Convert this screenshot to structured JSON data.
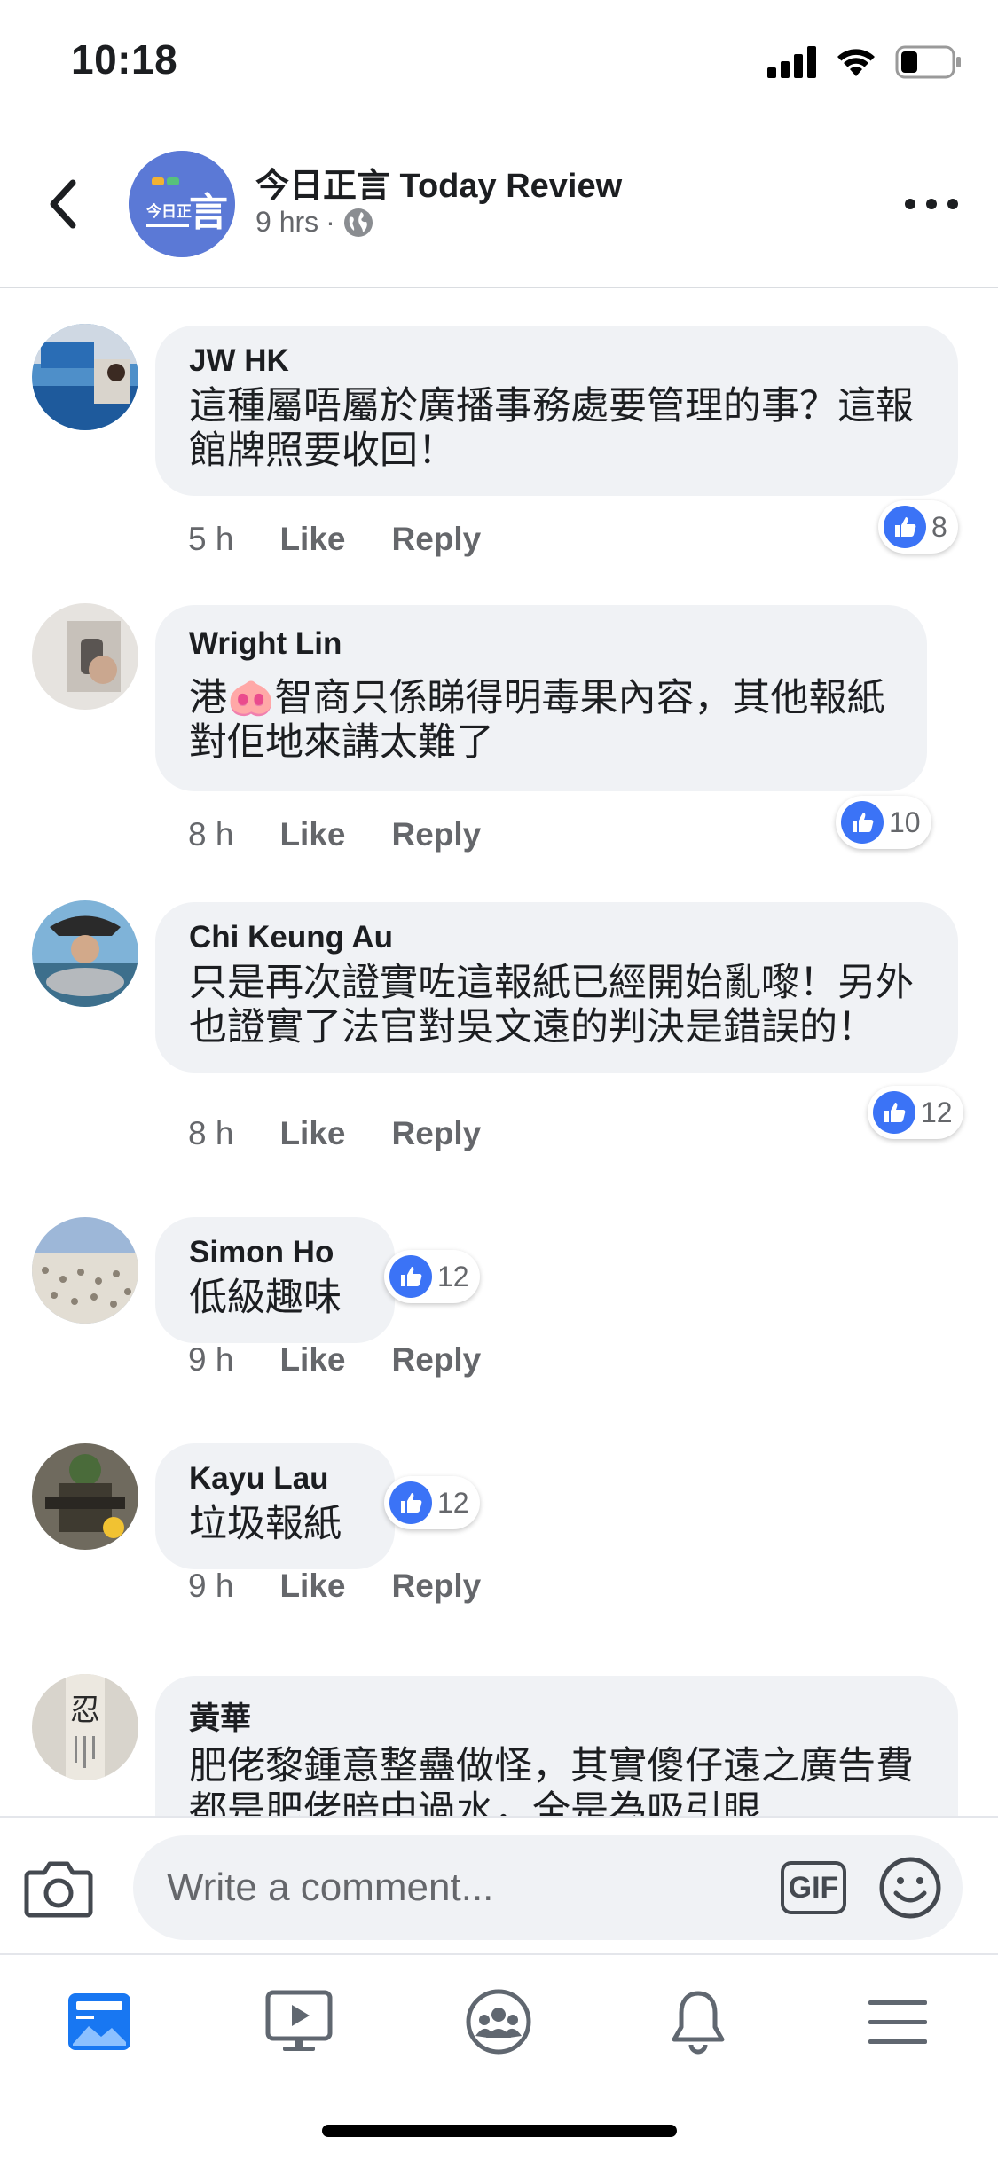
{
  "status_bar": {
    "time": "10:18"
  },
  "header": {
    "page_name": "今日正言 Today Review",
    "time_ago": "9 hrs",
    "separator": "·",
    "avatar_logo_text_top": "今日正",
    "avatar_logo_text_big": "言"
  },
  "comments": [
    {
      "author": "JW HK",
      "text": "這種屬唔屬於廣播事務處要管理的事？這報館牌照要收回！",
      "time": "5 h",
      "like_label": "Like",
      "reply_label": "Reply",
      "reaction_count": "8"
    },
    {
      "author": "Wright Lin",
      "text_before_emoji": "港",
      "emoji": "🐽",
      "text_after_emoji": "智商只係睇得明毒果內容，其他報紙對佢地來講太難了",
      "time": "8 h",
      "like_label": "Like",
      "reply_label": "Reply",
      "reaction_count": "10"
    },
    {
      "author": "Chi Keung Au",
      "text": "只是再次證實咗這報紙已經開始亂嚟！另外也證實了法官對吳文遠的判決是錯誤的！",
      "time": "8 h",
      "like_label": "Like",
      "reply_label": "Reply",
      "reaction_count": "12"
    },
    {
      "author": "Simon Ho",
      "text": "低級趣味",
      "time": "9 h",
      "like_label": "Like",
      "reply_label": "Reply",
      "reaction_count": "12"
    },
    {
      "author": "Kayu Lau",
      "text": "垃圾報紙",
      "time": "9 h",
      "like_label": "Like",
      "reply_label": "Reply",
      "reaction_count": "12"
    },
    {
      "author": "黃華",
      "text": "肥佬黎鍾意整蠱做怪，其實傻仔遠之廣告費都是肥佬暗中過水，全是為吸引眼",
      "avatar_char": "忍"
    }
  ],
  "composer": {
    "placeholder": "Write a comment...",
    "gif_label": "GIF"
  },
  "icons": {
    "back": "chevron-left-icon",
    "globe": "globe-icon",
    "more": "more-icon",
    "like": "thumbs-up-icon",
    "camera": "camera-icon",
    "emoji": "smiley-icon",
    "tabs": [
      "news-feed-icon",
      "watch-video-icon",
      "groups-icon",
      "notifications-bell-icon",
      "menu-icon"
    ]
  },
  "colors": {
    "like_blue": "#3b73f6",
    "tab_active": "#1877f2",
    "bubble_bg": "#f0f2f5",
    "secondary_text": "#65676b"
  }
}
